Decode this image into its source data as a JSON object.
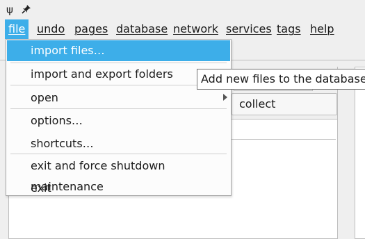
{
  "titlebar": {
    "app_icon": "psi-icon",
    "app_glyph": "ψ",
    "pin_icon": "pin-icon"
  },
  "menubar": {
    "items": [
      {
        "label": "file"
      },
      {
        "label": "undo"
      },
      {
        "label": "pages"
      },
      {
        "label": "database"
      },
      {
        "label": "network"
      },
      {
        "label": "services"
      },
      {
        "label": "tags"
      },
      {
        "label": "help"
      }
    ]
  },
  "file_menu": {
    "items": [
      {
        "label": "import files…"
      },
      {
        "label": "import and export folders"
      },
      {
        "label": "open"
      },
      {
        "label": "options…"
      },
      {
        "label": "shortcuts…"
      },
      {
        "label": "exit and force shutdown maintenance"
      },
      {
        "label": "exit"
      }
    ]
  },
  "tooltip": {
    "text": "Add new files to the database."
  },
  "background": {
    "collect_button": "collect unmatched"
  },
  "colors": {
    "accent": "#3daee9",
    "background": "#efefef"
  }
}
